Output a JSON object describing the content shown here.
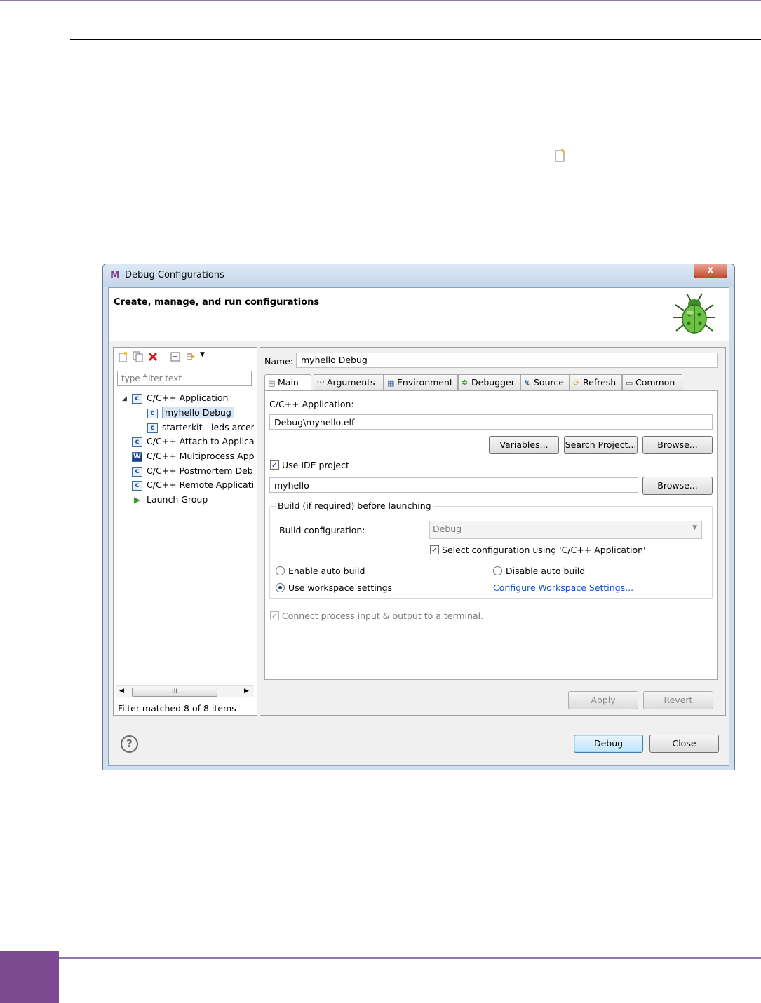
{
  "dialog": {
    "title": "Debug Configurations",
    "app_icon": "M",
    "close_glyph": "x",
    "banner_title": "Create, manage, and run configurations",
    "filter_placeholder": "type filter text",
    "filter_status": "Filter matched 8 of 8 items",
    "tree": [
      {
        "label": "C/C++ Application",
        "icon": "c"
      },
      {
        "label": "myhello Debug",
        "icon": "c"
      },
      {
        "label": "starterkit - leds arcem",
        "icon": "c"
      },
      {
        "label": "C/C++ Attach to Applica",
        "icon": "c"
      },
      {
        "label": "C/C++ Multiprocess App",
        "icon": "W"
      },
      {
        "label": "C/C++ Postmortem Deb",
        "icon": "c"
      },
      {
        "label": "C/C++ Remote Applicati",
        "icon": "c"
      },
      {
        "label": "Launch Group",
        "icon": "▶"
      }
    ],
    "scroll_thumb_label": "III",
    "name_label": "Name:",
    "name_value": "myhello Debug",
    "tabs": [
      "Main",
      "Arguments",
      "Environment",
      "Debugger",
      "Source",
      "Refresh",
      "Common"
    ],
    "main": {
      "app_label": "C/C++ Application:",
      "app_value": "Debug\\myhello.elf",
      "variables_button": "Variables...",
      "search_button": "Search Project...",
      "browse_button": "Browse...",
      "use_ide_label": "Use IDE project",
      "project_value": "myhello",
      "browse2_button": "Browse...",
      "group_title": "Build (if required) before launching",
      "build_config_label": "Build configuration:",
      "build_config_value": "Debug",
      "select_config_label": "Select configuration using 'C/C++ Application'",
      "enable_auto": "Enable auto build",
      "disable_auto": "Disable auto build",
      "use_workspace": "Use workspace settings",
      "configure_link": "Configure Workspace Settings...",
      "connect_label": "Connect process input & output to a terminal."
    },
    "apply_button": "Apply",
    "revert_button": "Revert",
    "debug_button": "Debug",
    "close_button": "Close",
    "help_glyph": "?"
  }
}
